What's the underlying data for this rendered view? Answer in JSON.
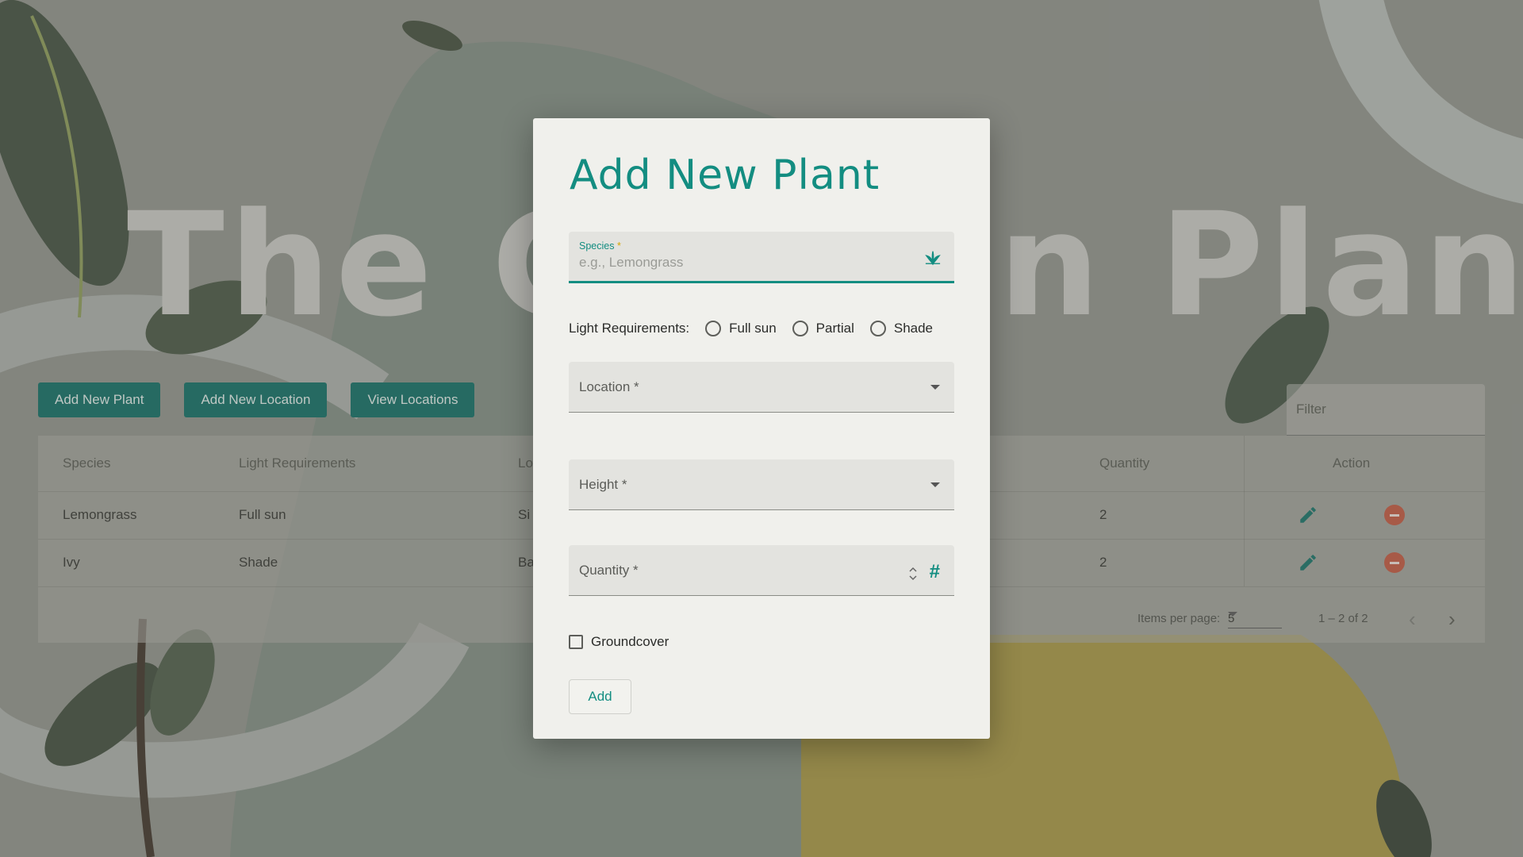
{
  "app": {
    "title": "The Garden Planner"
  },
  "actions": {
    "add_plant": "Add New Plant",
    "add_location": "Add New Location",
    "view_locations": "View Locations"
  },
  "filter": {
    "label": "Filter"
  },
  "table": {
    "headers": {
      "species": "Species",
      "light": "Light Requirements",
      "location": "Lo",
      "quantity": "Quantity",
      "action": "Action"
    },
    "rows": [
      {
        "species": "Lemongrass",
        "light": "Full sun",
        "location": "Si",
        "quantity": "2"
      },
      {
        "species": "Ivy",
        "light": "Shade",
        "location": "Ba",
        "quantity": "2"
      }
    ]
  },
  "paginator": {
    "label": "Items per page:",
    "size": "5",
    "range": "1 – 2 of 2"
  },
  "dialog": {
    "title": "Add New Plant",
    "species": {
      "label": "Species",
      "required_mark": "*",
      "placeholder": "e.g., Lemongrass"
    },
    "light": {
      "label": "Light Requirements:",
      "options": [
        "Full sun",
        "Partial",
        "Shade"
      ]
    },
    "location": {
      "label": "Location *"
    },
    "height": {
      "label": "Height *"
    },
    "quantity": {
      "label": "Quantity *"
    },
    "groundcover": {
      "label": "Groundcover"
    },
    "submit": "Add"
  },
  "colors": {
    "accent": "#138d81",
    "primary_button": "#0a6b62",
    "delete": "#c2533c",
    "yellow_blob": "#a6963f"
  },
  "icons": [
    "sprout-icon",
    "hash-icon",
    "edit-icon",
    "remove-icon",
    "chevron-left-icon",
    "chevron-right-icon",
    "dropdown-caret-icon"
  ]
}
